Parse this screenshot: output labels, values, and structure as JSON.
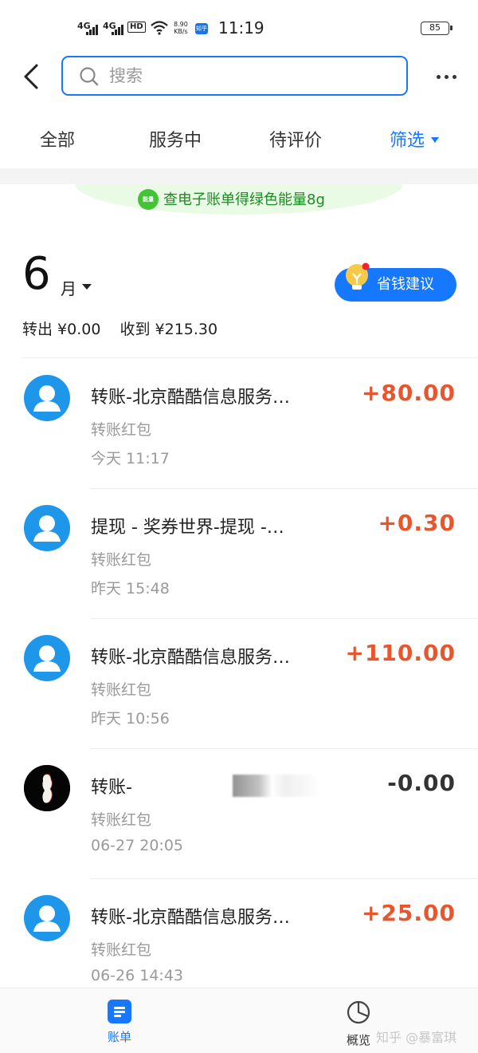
{
  "status_bar": {
    "signal_1": "4G",
    "signal_2": "4G",
    "hd": "HD",
    "speed_value": "8.90",
    "speed_unit": "KB/s",
    "time": "11:19",
    "battery": "85",
    "app_badge": "知乎"
  },
  "header": {
    "search_placeholder": "搜索"
  },
  "tabs": [
    {
      "label": "全部"
    },
    {
      "label": "服务中"
    },
    {
      "label": "待评价"
    },
    {
      "label": "筛选"
    }
  ],
  "promo": {
    "icon_text": "能量",
    "text": "查电子账单得绿色能量8g"
  },
  "summary": {
    "month": "6",
    "month_unit": "月",
    "save_button": "省钱建议",
    "out_label": "转出 ¥0.00",
    "in_label": "收到 ¥215.30"
  },
  "transactions": [
    {
      "title": "转账-北京酷酷信息服务…",
      "type": "转账红包",
      "time": "今天  11:17",
      "amount": "+80.00",
      "avatar": "default-user"
    },
    {
      "title": "提现 - 奖券世界-提现 -…",
      "type": "转账红包",
      "time": "昨天  15:48",
      "amount": "+0.30",
      "avatar": "default-user"
    },
    {
      "title": "转账-北京酷酷信息服务…",
      "type": "转账红包",
      "time": "昨天  10:56",
      "amount": "+110.00",
      "avatar": "default-user"
    },
    {
      "title": "转账-",
      "type": "转账红包",
      "time": "06-27  20:05",
      "amount": "-0.00",
      "avatar": "custom-photo"
    },
    {
      "title": "转账-北京酷酷信息服务…",
      "type": "转账红包",
      "time": "06-26  14:43",
      "amount": "+25.00",
      "avatar": "default-user"
    }
  ],
  "bottom_nav": {
    "bill": "账单",
    "overview": "概览",
    "watermark": "知乎 @暴富琪"
  },
  "colors": {
    "accent": "#1677ff",
    "income": "#e8562d",
    "promo_green": "#1e8a25"
  }
}
